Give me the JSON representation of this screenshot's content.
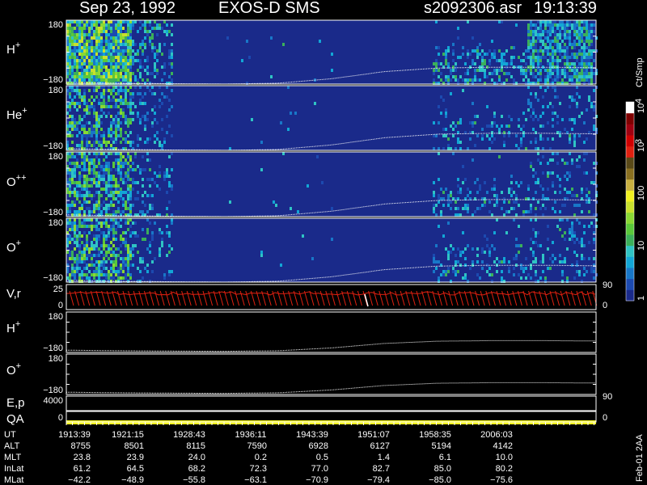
{
  "header": {
    "date": "Sep 23, 1992",
    "instrument": "EXOS-D SMS",
    "file": "s2092306.asr",
    "time": "19:13:39"
  },
  "side_labels": {
    "units": "Ct/Smp",
    "stamp": "Feb-01 2AA"
  },
  "colorbar": {
    "tick_labels": [
      "1",
      "10",
      "100",
      "10",
      "3",
      "10",
      "4"
    ],
    "colors": [
      "#1a2a8a",
      "#1c4ab0",
      "#1877c8",
      "#12a6d6",
      "#2fc4c4",
      "#3bb05a",
      "#5ac83a",
      "#8ad834",
      "#c8e02c",
      "#f0f020",
      "#c8b040",
      "#8a7020",
      "#5a4a18",
      "#e02010",
      "#d00000",
      "#a00010",
      "#800000",
      "#ffffff"
    ]
  },
  "panels": [
    {
      "id": "h_plus_spectrogram",
      "label": "H",
      "sup": "+",
      "ymax": "180",
      "ymin": "−180"
    },
    {
      "id": "he_plus_spectrogram",
      "label": "He",
      "sup": "+",
      "ymax": "180",
      "ymin": "−180"
    },
    {
      "id": "o_pp_spectrogram",
      "label": "O",
      "sup": "++",
      "ymax": "180",
      "ymin": "−180"
    },
    {
      "id": "o_plus_spectrogram",
      "label": "O",
      "sup": "+",
      "ymax": "180",
      "ymin": "−180"
    },
    {
      "id": "velocity_panel",
      "label": "V,r",
      "sup": "",
      "ymax": "25",
      "ymin": "0",
      "right_max": "90",
      "right_min": "0"
    },
    {
      "id": "h_plus_line",
      "label": "H",
      "sup": "+",
      "ymax": "180",
      "ymin": "−180"
    },
    {
      "id": "o_plus_line",
      "label": "O",
      "sup": "+",
      "ymax": "180",
      "ymin": "−180"
    },
    {
      "id": "ep_panel",
      "label": "E,p",
      "sup": "",
      "ymax": "4000",
      "ymin": "",
      "right_max": "90",
      "right_min": ""
    },
    {
      "id": "qa_panel",
      "label": "QA",
      "sup": "",
      "ymax": "",
      "ymin": "0",
      "right_max": "",
      "right_min": "0"
    }
  ],
  "chart_data": {
    "type": "heatmap",
    "x_label": "UT",
    "x_ticks": [
      "1913:39",
      "1921:15",
      "1928:43",
      "1936:11",
      "1943:39",
      "1951:07",
      "1958:35",
      "2006:03"
    ],
    "ephemeris": [
      {
        "name": "UT",
        "values": [
          "1913:39",
          "1921:15",
          "1928:43",
          "1936:11",
          "1943:39",
          "1951:07",
          "1958:35",
          "2006:03"
        ]
      },
      {
        "name": "ALT",
        "values": [
          "8755",
          "8501",
          "8115",
          "7590",
          "6928",
          "6127",
          "5194",
          "4142"
        ]
      },
      {
        "name": "MLT",
        "values": [
          "23.8",
          "23.9",
          "24.0",
          "0.2",
          "0.5",
          "1.4",
          "6.1",
          "10.0"
        ]
      },
      {
        "name": "InLat",
        "values": [
          "61.2",
          "64.5",
          "68.2",
          "72.3",
          "77.0",
          "82.7",
          "85.0",
          "80.2"
        ]
      },
      {
        "name": "MLat",
        "values": [
          "−42.2",
          "−48.9",
          "−55.8",
          "−63.1",
          "−70.9",
          "−79.4",
          "−85.0",
          "−75.6"
        ]
      }
    ],
    "pitch_angle_ylim": [
      -180,
      180
    ],
    "pitch_angle_trace": [
      [
        0,
        -170
      ],
      [
        0.1,
        -175
      ],
      [
        0.2,
        -178
      ],
      [
        0.3,
        -180
      ],
      [
        0.4,
        -175
      ],
      [
        0.5,
        -150
      ],
      [
        0.6,
        -110
      ],
      [
        0.7,
        -90
      ],
      [
        0.8,
        -85
      ],
      [
        0.9,
        -85
      ],
      [
        1.0,
        -88
      ]
    ],
    "colorbar_scale": "log",
    "colorbar_range": [
      1,
      10000
    ],
    "units": "Ct/Smp"
  }
}
